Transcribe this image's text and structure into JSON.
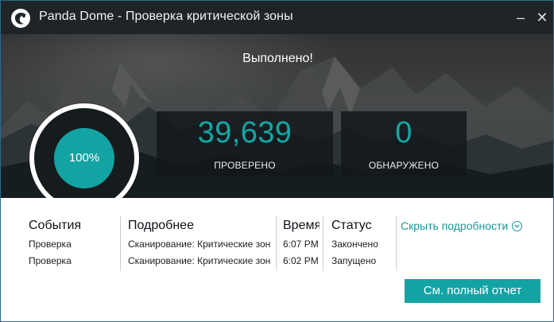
{
  "window": {
    "title": "Panda Dome - Проверка критической зоны",
    "controls": {
      "minimize_icon": "–",
      "close_icon": "✕"
    }
  },
  "scan": {
    "status_title": "Выполнено!",
    "progress": "100%",
    "stats": [
      {
        "value": "39,639",
        "label": "ПРОВЕРЕНО"
      },
      {
        "value": "0",
        "label": "ОБНАРУЖЕНО"
      }
    ]
  },
  "details": {
    "columns": {
      "events": "События",
      "details": "Подробнее",
      "time": "Время",
      "status": "Статус"
    },
    "rows": [
      {
        "event": "Проверка",
        "details": "Сканирование: Критические зоны",
        "time": "6:07 PM",
        "status": "Закончено"
      },
      {
        "event": "Проверка",
        "details": "Сканирование: Критические зоны",
        "time": "6:02 PM",
        "status": "Запущено"
      }
    ],
    "hide_details": "Скрыть подробности",
    "report_button": "См. полный отчет"
  },
  "colors": {
    "accent": "#14a3a3",
    "title_bar": "#1f2428",
    "hero_dark": "#161b1e",
    "text_dark": "#0d1217"
  },
  "icons": {
    "logo": "panda-logo-icon",
    "expand": "chevron-down-icon"
  }
}
